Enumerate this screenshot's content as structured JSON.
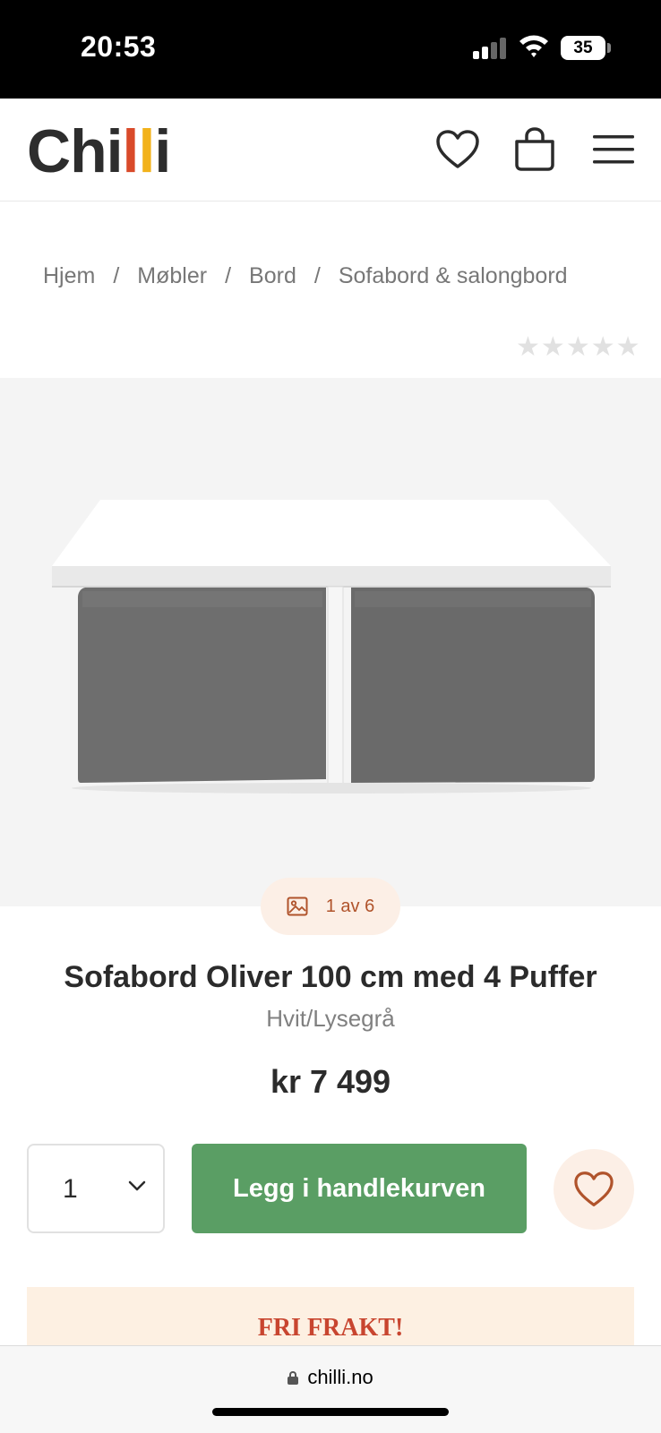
{
  "status_bar": {
    "time": "20:53",
    "battery": "35"
  },
  "header": {
    "logo": {
      "part1": "Chi",
      "part2": "l",
      "part3": "l",
      "part4": "i"
    },
    "icons": [
      "heart-icon",
      "shopping-bag-icon",
      "menu-icon"
    ]
  },
  "breadcrumb": {
    "items": [
      "Hjem",
      "Møbler",
      "Bord",
      "Sofabord & salongbord"
    ],
    "separator": "/"
  },
  "rating": {
    "stars_filled": 0,
    "stars_total": 5
  },
  "gallery": {
    "counter": "1 av 6"
  },
  "product": {
    "title": "Sofabord Oliver 100 cm med 4 Puffer",
    "variant": "Hvit/Lysegrå",
    "price": "kr 7 499"
  },
  "purchase": {
    "quantity": "1",
    "add_to_cart_label": "Legg i handlekurven"
  },
  "banner": {
    "text": "FRI FRAKT!"
  },
  "browser": {
    "url": "chilli.no"
  },
  "colors": {
    "accent_green": "#5a9e64",
    "accent_orange": "#b0532b",
    "banner_bg": "#fdf0e2",
    "banner_text": "#c8452f"
  }
}
